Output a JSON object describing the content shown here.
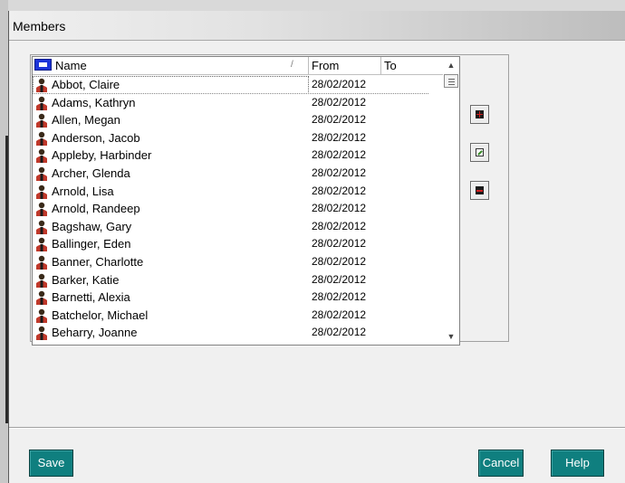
{
  "window": {
    "title": "Members"
  },
  "list": {
    "columns": [
      {
        "label": "Name",
        "sort_indicator": "/"
      },
      {
        "label": "From"
      },
      {
        "label": "To"
      }
    ],
    "rows": [
      {
        "name": "Abbot, Claire",
        "from": "28/02/2012",
        "to": "",
        "selected": true
      },
      {
        "name": "Adams, Kathryn",
        "from": "28/02/2012",
        "to": ""
      },
      {
        "name": "Allen, Megan",
        "from": "28/02/2012",
        "to": ""
      },
      {
        "name": "Anderson, Jacob",
        "from": "28/02/2012",
        "to": ""
      },
      {
        "name": "Appleby, Harbinder",
        "from": "28/02/2012",
        "to": ""
      },
      {
        "name": "Archer, Glenda",
        "from": "28/02/2012",
        "to": ""
      },
      {
        "name": "Arnold, Lisa",
        "from": "28/02/2012",
        "to": ""
      },
      {
        "name": "Arnold, Randeep",
        "from": "28/02/2012",
        "to": ""
      },
      {
        "name": "Bagshaw, Gary",
        "from": "28/02/2012",
        "to": ""
      },
      {
        "name": "Ballinger, Eden",
        "from": "28/02/2012",
        "to": ""
      },
      {
        "name": "Banner, Charlotte",
        "from": "28/02/2012",
        "to": ""
      },
      {
        "name": "Barker, Katie",
        "from": "28/02/2012",
        "to": ""
      },
      {
        "name": "Barnetti, Alexia",
        "from": "28/02/2012",
        "to": ""
      },
      {
        "name": "Batchelor, Michael",
        "from": "28/02/2012",
        "to": ""
      },
      {
        "name": "Beharry, Joanne",
        "from": "28/02/2012",
        "to": ""
      }
    ]
  },
  "side_buttons": {
    "add": {
      "icon": "plus-icon"
    },
    "edit": {
      "icon": "pencil-icon"
    },
    "remove": {
      "icon": "minus-icon"
    }
  },
  "footer": {
    "save_label": "Save",
    "cancel_label": "Cancel",
    "help_label": "Help"
  },
  "colors": {
    "button_bg": "#0f7f7f",
    "header_icon": "#1c34d8",
    "person_icon_red": "#c0392b"
  }
}
